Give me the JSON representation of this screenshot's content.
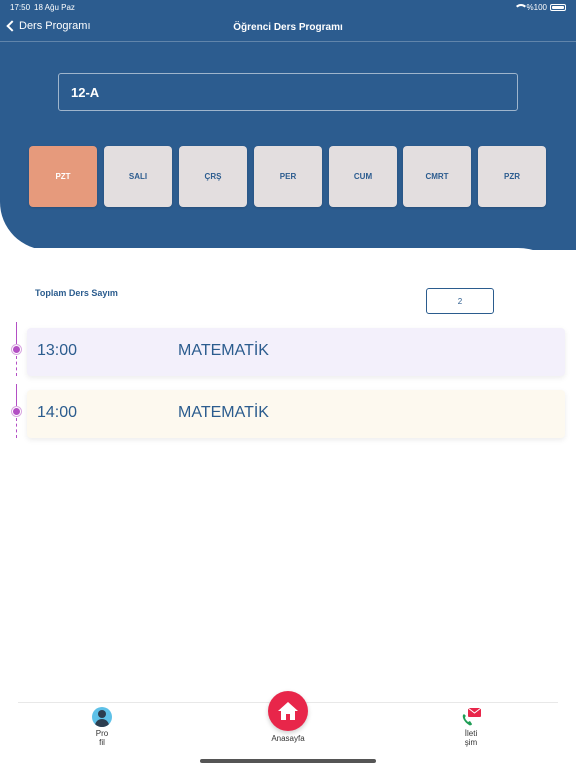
{
  "status_bar": {
    "time": "17:50",
    "date": "18 Ağu Paz",
    "battery": "%100"
  },
  "nav": {
    "back_label": "Ders Programı",
    "title": "Öğrenci Ders Programı"
  },
  "class_field": {
    "value": "12-A"
  },
  "days": [
    {
      "label": "PZT",
      "active": true
    },
    {
      "label": "SALI",
      "active": false
    },
    {
      "label": "ÇRŞ",
      "active": false
    },
    {
      "label": "PER",
      "active": false
    },
    {
      "label": "CUM",
      "active": false
    },
    {
      "label": "CMRT",
      "active": false
    },
    {
      "label": "PZR",
      "active": false
    }
  ],
  "summary": {
    "label": "Toplam Ders Sayım",
    "count": "2"
  },
  "lessons": [
    {
      "time": "13:00",
      "subject": "MATEMATİK",
      "color": "#f3f0fb"
    },
    {
      "time": "14:00",
      "subject": "MATEMATİK",
      "color": "#fdf9ef"
    }
  ],
  "colors": {
    "header": "#2c5c8f",
    "active_day": "#e69a7c",
    "day_button": "#e3dedf",
    "accent_text": "#2b5c8e",
    "timeline": "#b34fc4",
    "home": "#e8264a"
  },
  "tab_bar": {
    "profile": {
      "label_line1": "Pro",
      "label_line2": "fil",
      "icon": "profile-icon"
    },
    "home": {
      "label": "Anasayfa",
      "icon": "home-icon"
    },
    "contact": {
      "label_line1": "İleti",
      "label_line2": "şim",
      "icon": "phone-mail-icon"
    }
  }
}
